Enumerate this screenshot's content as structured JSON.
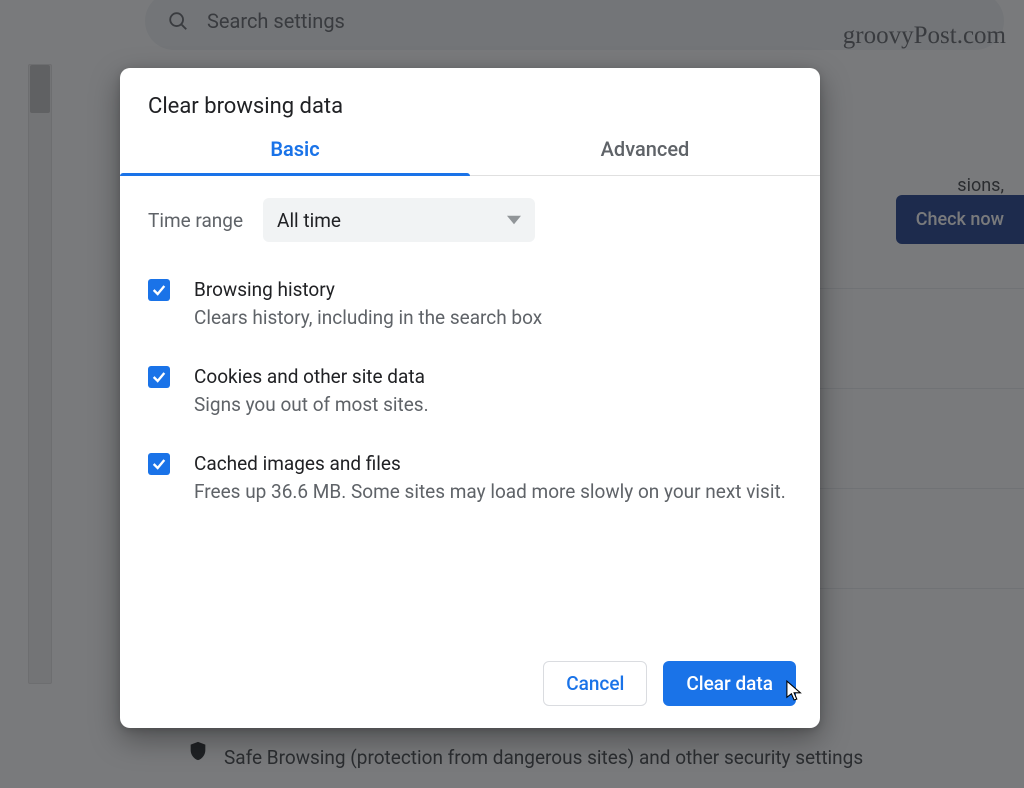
{
  "search": {
    "placeholder": "Search settings"
  },
  "watermark": "groovyPost.com",
  "background": {
    "partial_text": "sions,",
    "check_button": "Check now",
    "footer_text": "Safe Browsing (protection from dangerous sites) and other security settings"
  },
  "dialog": {
    "title": "Clear browsing data",
    "tabs": {
      "basic": "Basic",
      "advanced": "Advanced"
    },
    "time_label": "Time range",
    "time_value": "All time",
    "options": [
      {
        "title": "Browsing history",
        "desc": "Clears history, including in the search box"
      },
      {
        "title": "Cookies and other site data",
        "desc": "Signs you out of most sites."
      },
      {
        "title": "Cached images and files",
        "desc": "Frees up 36.6 MB. Some sites may load more slowly on your next visit."
      }
    ],
    "cancel": "Cancel",
    "confirm": "Clear data"
  }
}
